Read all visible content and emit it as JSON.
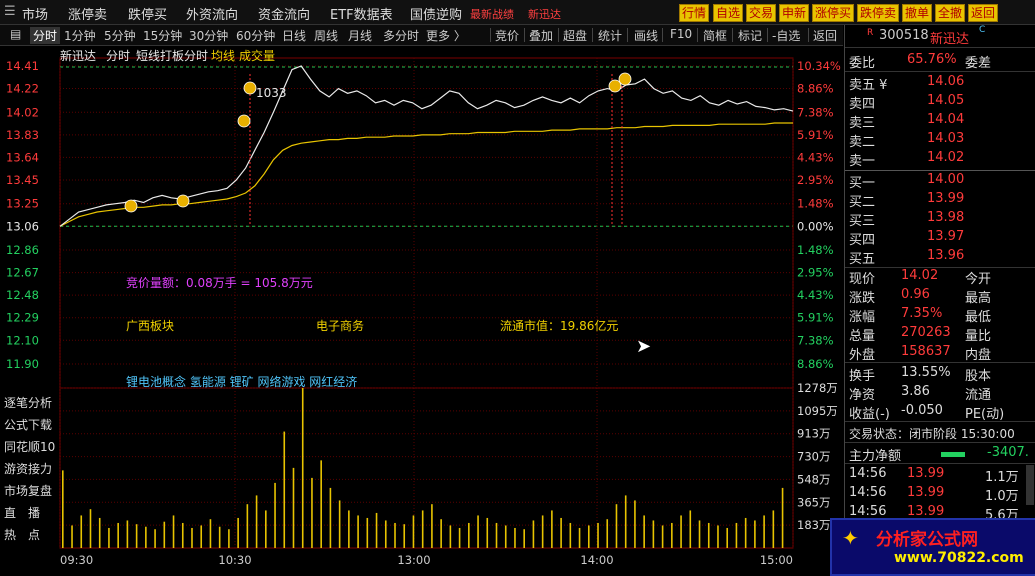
{
  "menu": [
    "市场",
    "涨停卖",
    "跌停买",
    "外资流向",
    "资金流向",
    "ETF数据表",
    "国债逆购",
    "最新战绩",
    "新迅达"
  ],
  "toolbar_buttons": [
    "行情",
    "自选",
    "交易",
    "申新",
    "涨停买",
    "跌停卖",
    "撤单",
    "全撤",
    "返回"
  ],
  "tabs": [
    "分时",
    "1分钟",
    "5分钟",
    "15分钟",
    "30分钟",
    "60分钟",
    "日线",
    "周线",
    "月线",
    "多分时",
    "更多 〉"
  ],
  "tools": [
    "竞价",
    "叠加",
    "超盘",
    "统计",
    "画线",
    "F10",
    "简框",
    "标记",
    "-自选",
    "返回"
  ],
  "chart_header": {
    "name": "新迅达",
    "mode": "分时",
    "indicator": "短线打板分时",
    "avg_label": "均线",
    "vol_label": "成交量"
  },
  "chart_data": {
    "type": "line",
    "y_price_ticks": [
      "14.41",
      "14.22",
      "14.02",
      "13.83",
      "13.64",
      "13.45",
      "13.25",
      "13.06",
      "12.86",
      "12.67",
      "12.48",
      "12.29",
      "12.10",
      "11.90"
    ],
    "y_pct_ticks": [
      "10.34%",
      "8.86%",
      "7.38%",
      "5.91%",
      "4.43%",
      "2.95%",
      "1.48%",
      "0.00%",
      "1.48%",
      "2.95%",
      "4.43%",
      "5.91%",
      "7.38%",
      "8.86%"
    ],
    "vol_ticks": [
      "1278万",
      "1095万",
      "913万",
      "730万",
      "548万",
      "365万",
      "183万"
    ],
    "x_ticks": [
      "09:30",
      "10:30",
      "13:00",
      "14:00",
      "15:00"
    ],
    "ylim": [
      11.9,
      14.41
    ],
    "prev_close": 13.06,
    "annotation": "1033",
    "price_series": [
      13.06,
      13.12,
      13.18,
      13.2,
      13.22,
      13.24,
      13.25,
      13.26,
      13.28,
      13.26,
      13.3,
      13.32,
      13.3,
      13.29,
      13.31,
      13.33,
      13.35,
      13.36,
      13.38,
      13.45,
      13.55,
      13.7,
      13.85,
      14.02,
      14.2,
      14.38,
      14.41,
      14.3,
      14.2,
      14.15,
      14.22,
      14.18,
      14.2,
      14.16,
      14.1,
      14.12,
      14.08,
      14.12,
      14.1,
      14.05,
      14.08,
      14.14,
      14.2,
      14.18,
      14.1,
      14.05,
      14.08,
      14.12,
      14.1,
      14.06,
      14.08,
      14.12,
      14.15,
      14.12,
      14.1,
      14.14,
      14.1,
      14.16,
      14.2,
      14.22,
      14.2,
      14.25,
      14.26,
      14.3,
      14.22,
      14.18,
      14.2,
      14.14,
      14.12,
      14.16,
      14.1,
      14.08,
      14.12,
      14.09,
      14.11,
      14.07,
      14.06,
      14.04,
      14.05,
      14.03
    ],
    "avg_series": [
      13.06,
      13.1,
      13.14,
      13.16,
      13.18,
      13.19,
      13.2,
      13.21,
      13.22,
      13.22,
      13.23,
      13.24,
      13.24,
      13.25,
      13.25,
      13.26,
      13.27,
      13.28,
      13.29,
      13.31,
      13.34,
      13.4,
      13.5,
      13.62,
      13.7,
      13.74,
      13.76,
      13.77,
      13.78,
      13.79,
      13.79,
      13.8,
      13.8,
      13.81,
      13.81,
      13.81,
      13.82,
      13.82,
      13.82,
      13.83,
      13.83,
      13.83,
      13.84,
      13.84,
      13.84,
      13.85,
      13.85,
      13.85,
      13.85,
      13.86,
      13.86,
      13.86,
      13.86,
      13.87,
      13.87,
      13.87,
      13.88,
      13.88,
      13.88,
      13.88,
      13.89,
      13.89,
      13.89,
      13.9,
      13.9,
      13.9,
      13.91,
      13.91,
      13.91,
      13.91,
      13.91,
      13.92,
      13.92,
      13.92,
      13.92,
      13.92,
      13.92,
      13.93,
      13.93,
      13.93
    ],
    "volume_series": [
      620,
      180,
      260,
      310,
      240,
      160,
      200,
      220,
      190,
      170,
      150,
      210,
      260,
      200,
      160,
      180,
      230,
      170,
      150,
      240,
      350,
      420,
      300,
      520,
      930,
      640,
      1278,
      560,
      700,
      480,
      380,
      300,
      260,
      240,
      280,
      220,
      200,
      190,
      260,
      300,
      350,
      230,
      180,
      160,
      200,
      260,
      240,
      200,
      180,
      160,
      150,
      220,
      260,
      300,
      240,
      200,
      160,
      180,
      200,
      230,
      350,
      420,
      380,
      260,
      220,
      180,
      200,
      260,
      300,
      220,
      200,
      180,
      160,
      200,
      240,
      220,
      260,
      300,
      480
    ]
  },
  "overlay_text": {
    "bid_amount": "竞价量额：0.08万手 = 105.8万元",
    "region": "广西板块",
    "industry": "电子商务",
    "float_cap": "流通市值：19.86亿元",
    "concepts": "锂电池概念 氢能源 锂矿 网络游戏 网红经济"
  },
  "left_panel": [
    "逐笔分析",
    "公式下载",
    "同花顺10",
    "游资接力",
    "市场复盘",
    "直　播",
    "热　点"
  ],
  "side": {
    "code": "300518",
    "name": "新迅达",
    "suffix": "C",
    "flag": "R",
    "weibi_label": "委比",
    "weibi": "65.76%",
    "weicha_label": "委差",
    "asks": [
      {
        "label": "卖五 ¥",
        "price": "14.06"
      },
      {
        "label": "卖四",
        "price": "14.05"
      },
      {
        "label": "卖三",
        "price": "14.04"
      },
      {
        "label": "卖二",
        "price": "14.03"
      },
      {
        "label": "卖一",
        "price": "14.02"
      }
    ],
    "bids": [
      {
        "label": "买一",
        "price": "14.00"
      },
      {
        "label": "买二",
        "price": "13.99"
      },
      {
        "label": "买三",
        "price": "13.98"
      },
      {
        "label": "买四",
        "price": "13.97"
      },
      {
        "label": "买五",
        "price": "13.96"
      }
    ],
    "stats": [
      {
        "l1": "现价",
        "v1": "14.02",
        "l2": "今开"
      },
      {
        "l1": "涨跌",
        "v1": "0.96",
        "l2": "最高"
      },
      {
        "l1": "涨幅",
        "v1": "7.35%",
        "l2": "最低"
      },
      {
        "l1": "总量",
        "v1": "270263",
        "l2": "量比"
      },
      {
        "l1": "外盘",
        "v1": "158637",
        "l2": "内盘"
      }
    ],
    "stats2": [
      {
        "l1": "换手",
        "v1": "13.55%",
        "l2": "股本"
      },
      {
        "l1": "净资",
        "v1": "3.86",
        "l2": "流通"
      },
      {
        "l1": "收益(-)",
        "v1": "-0.050",
        "l2": "PE(动)"
      }
    ],
    "status": "交易状态：闭市阶段 15:30:00",
    "main_flow_label": "主力净额",
    "main_flow_value": "-3407.",
    "ticks": [
      {
        "time": "14:56",
        "price": "13.99",
        "vol": "1.1万"
      },
      {
        "time": "14:56",
        "price": "13.99",
        "vol": "1.0万"
      },
      {
        "time": "14:56",
        "price": "13.99",
        "vol": "5.6万"
      }
    ]
  },
  "watermark": {
    "title": "分析家公式网",
    "url": "www.70822.com"
  }
}
